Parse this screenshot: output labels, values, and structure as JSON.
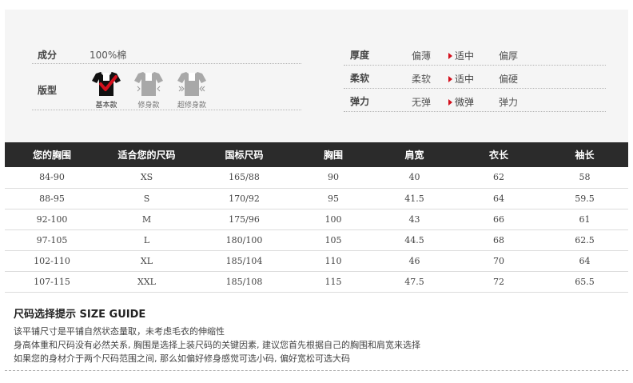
{
  "attributes": {
    "composition": {
      "label": "成分",
      "value": "100%棉"
    },
    "fit": {
      "label": "版型",
      "options": [
        {
          "name": "基本款",
          "active": true
        },
        {
          "name": "修身款",
          "active": false
        },
        {
          "name": "超修身款",
          "active": false
        }
      ]
    },
    "thickness": {
      "label": "厚度",
      "options": [
        "偏薄",
        "适中",
        "偏厚"
      ],
      "selected": "适中"
    },
    "softness": {
      "label": "柔软",
      "options": [
        "柔软",
        "适中",
        "偏硬"
      ],
      "selected": "适中"
    },
    "elasticity": {
      "label": "弹力",
      "options": [
        "无弹",
        "微弹",
        "弹力"
      ],
      "selected": "微弹"
    }
  },
  "size_table": {
    "headers": [
      "您的胸围",
      "适合您的尺码",
      "国标尺码",
      "胸围",
      "肩宽",
      "衣长",
      "袖长"
    ],
    "rows": [
      [
        "84-90",
        "XS",
        "165/88",
        "90",
        "40",
        "62",
        "58"
      ],
      [
        "88-95",
        "S",
        "170/92",
        "95",
        "41.5",
        "64",
        "59.5"
      ],
      [
        "92-100",
        "M",
        "175/96",
        "100",
        "43",
        "66",
        "61"
      ],
      [
        "97-105",
        "L",
        "180/100",
        "105",
        "44.5",
        "68",
        "62.5"
      ],
      [
        "102-110",
        "XL",
        "185/104",
        "110",
        "46",
        "70",
        "64"
      ],
      [
        "107-115",
        "XXL",
        "185/108",
        "115",
        "47.5",
        "72",
        "65.5"
      ]
    ]
  },
  "guide": {
    "title": "尺码选择提示 SIZE GUIDE",
    "lines": [
      "该平铺尺寸是平铺自然状态量取，未考虑毛衣的伸缩性",
      "身高体重和尺码没有必然关系, 胸围是选择上装尺码的关键因素, 建议您首先根据自己的胸围和肩宽来选择",
      "如果您的身材介于两个尺码范围之间, 那么如偏好修身感觉可选小码, 偏好宽松可选大码"
    ]
  },
  "colors": {
    "accent": "#d4101d",
    "header_bg": "#2b2b2b",
    "panel_bg": "#f5f5f5",
    "shirt_active": "#111111",
    "shirt_inactive": "#a8a8a8"
  }
}
